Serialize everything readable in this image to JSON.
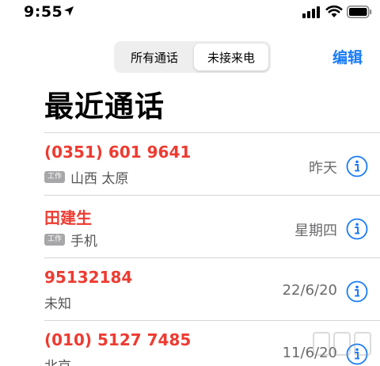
{
  "status_bar": {
    "time": "9:55",
    "icons": [
      "location-arrow-icon",
      "signal-icon",
      "wifi-icon",
      "battery-icon"
    ]
  },
  "segments": {
    "all_calls": "所有通话",
    "missed": "未接来电",
    "selected": "missed"
  },
  "edit_label": "编辑",
  "title": "最近通话",
  "colors": {
    "accent": "#1a7cf6",
    "missed_call": "#ee3b31",
    "secondary_text": "#6b6b6e",
    "badge": "#a7a7a9"
  },
  "calls": [
    {
      "name": "(0351) 601 9641",
      "badge": "工作",
      "detail": "山西 太原",
      "date": "昨天"
    },
    {
      "name": "田建生",
      "badge": "工作",
      "detail": "手机",
      "date": "星期四"
    },
    {
      "name": "95132184",
      "badge": "",
      "detail": "未知",
      "date": "22/6/20"
    },
    {
      "name": "(010) 5127 7485",
      "badge": "",
      "detail": "北京",
      "date": "11/6/20"
    }
  ]
}
